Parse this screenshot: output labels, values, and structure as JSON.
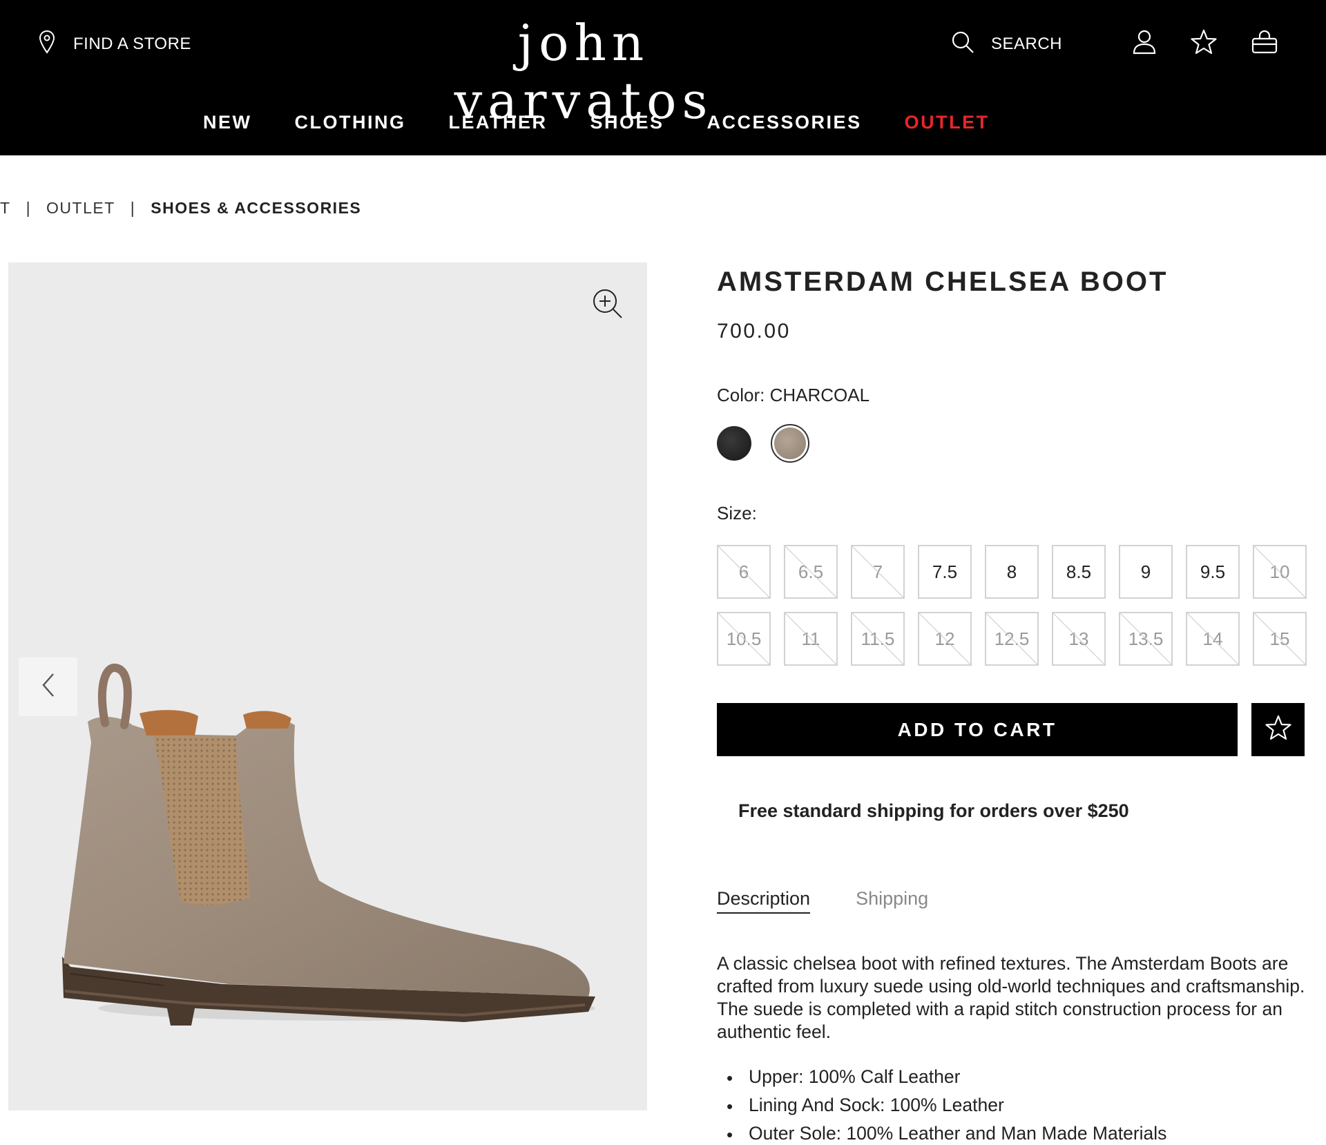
{
  "header": {
    "find_store": "FIND A STORE",
    "logo": "john varvatos",
    "search": "SEARCH",
    "nav": [
      "NEW",
      "CLOTHING",
      "LEATHER",
      "SHOES",
      "ACCESSORIES",
      "OUTLET"
    ],
    "outlet_color": "#e8262b"
  },
  "breadcrumb": {
    "items": [
      "T",
      "OUTLET",
      "SHOES & ACCESSORIES"
    ]
  },
  "product": {
    "title": "AMSTERDAM CHELSEA BOOT",
    "price": "700.00",
    "color_label": "Color:",
    "color_value": "CHARCOAL",
    "swatches": [
      {
        "name": "black",
        "color": "#1e1e1e",
        "selected": false
      },
      {
        "name": "charcoal",
        "color": "#a39382",
        "selected": true
      }
    ],
    "size_label": "Size:",
    "sizes": [
      {
        "v": "6",
        "avail": false
      },
      {
        "v": "6.5",
        "avail": false
      },
      {
        "v": "7",
        "avail": false
      },
      {
        "v": "7.5",
        "avail": true
      },
      {
        "v": "8",
        "avail": true
      },
      {
        "v": "8.5",
        "avail": true
      },
      {
        "v": "9",
        "avail": true
      },
      {
        "v": "9.5",
        "avail": true
      },
      {
        "v": "10",
        "avail": false
      },
      {
        "v": "10.5",
        "avail": false
      },
      {
        "v": "11",
        "avail": false
      },
      {
        "v": "11.5",
        "avail": false
      },
      {
        "v": "12",
        "avail": false
      },
      {
        "v": "12.5",
        "avail": false
      },
      {
        "v": "13",
        "avail": false
      },
      {
        "v": "13.5",
        "avail": false
      },
      {
        "v": "14",
        "avail": false
      },
      {
        "v": "15",
        "avail": false
      }
    ],
    "add_to_cart": "ADD TO CART",
    "shipping_note": "Free standard shipping for orders over $250",
    "tabs": [
      "Description",
      "Shipping"
    ],
    "active_tab": "Description",
    "description": "A classic chelsea boot with refined textures. The Amsterdam Boots are crafted from luxury suede using old-world techniques and craftsmanship. The suede is completed with a rapid stitch construction process for an authentic feel.",
    "features": [
      "Upper: 100% Calf Leather",
      "Lining And Sock: 100% Leather",
      "Outer Sole: 100% Leather and Man Made Materials"
    ]
  },
  "icons": {
    "find_store": "map-pin-icon",
    "search": "search-icon",
    "account": "user-icon",
    "wishlist": "star-icon",
    "bag": "shopping-bag-icon",
    "zoom": "zoom-in-icon",
    "prev": "chevron-left-icon"
  }
}
